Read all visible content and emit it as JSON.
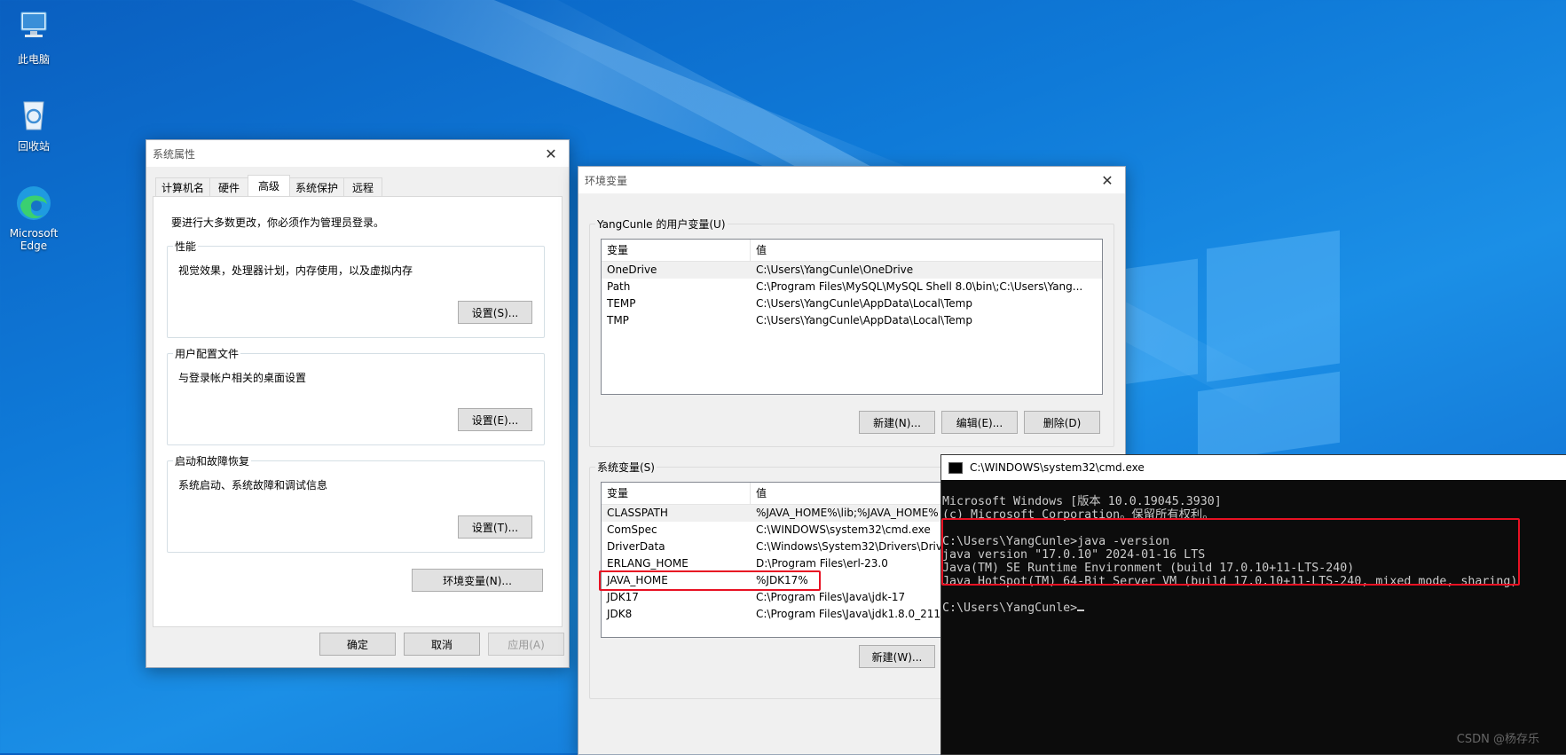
{
  "desktop": {
    "icons": [
      {
        "label": "此电脑",
        "icon": "this-pc-icon"
      },
      {
        "label": "回收站",
        "icon": "recycle-bin-icon"
      },
      {
        "label": "Microsoft Edge",
        "icon": "edge-icon"
      }
    ]
  },
  "sys_props": {
    "title": "系统属性",
    "tabs": [
      "计算机名",
      "硬件",
      "高级",
      "系统保护",
      "远程"
    ],
    "active_tab": "高级",
    "admin_note": "要进行大多数更改，你必须作为管理员登录。",
    "performance": {
      "legend": "性能",
      "desc": "视觉效果，处理器计划，内存使用，以及虚拟内存",
      "button": "设置(S)..."
    },
    "user_profile": {
      "legend": "用户配置文件",
      "desc": "与登录帐户相关的桌面设置",
      "button": "设置(E)..."
    },
    "startup": {
      "legend": "启动和故障恢复",
      "desc": "系统启动、系统故障和调试信息",
      "button": "设置(T)..."
    },
    "env_button": "环境变量(N)...",
    "ok": "确定",
    "cancel": "取消",
    "apply": "应用(A)"
  },
  "env_vars": {
    "title": "环境变量",
    "user_section": "YangCunle 的用户变量(U)",
    "col_var": "变量",
    "col_val": "值",
    "user_rows": [
      {
        "name": "OneDrive",
        "value": "C:\\Users\\YangCunle\\OneDrive"
      },
      {
        "name": "Path",
        "value": "C:\\Program Files\\MySQL\\MySQL Shell 8.0\\bin\\;C:\\Users\\Yang..."
      },
      {
        "name": "TEMP",
        "value": "C:\\Users\\YangCunle\\AppData\\Local\\Temp"
      },
      {
        "name": "TMP",
        "value": "C:\\Users\\YangCunle\\AppData\\Local\\Temp"
      }
    ],
    "user_buttons": {
      "new": "新建(N)...",
      "edit": "编辑(E)...",
      "delete": "删除(D)"
    },
    "sys_section": "系统变量(S)",
    "sys_rows": [
      {
        "name": "CLASSPATH",
        "value": "%JAVA_HOME%\\lib;%JAVA_HOME%"
      },
      {
        "name": "ComSpec",
        "value": "C:\\WINDOWS\\system32\\cmd.exe"
      },
      {
        "name": "DriverData",
        "value": "C:\\Windows\\System32\\Drivers\\Driv"
      },
      {
        "name": "ERLANG_HOME",
        "value": "D:\\Program Files\\erl-23.0"
      },
      {
        "name": "JAVA_HOME",
        "value": "%JDK17%"
      },
      {
        "name": "JDK17",
        "value": "C:\\Program Files\\Java\\jdk-17"
      },
      {
        "name": "JDK8",
        "value": "C:\\Program Files\\Java\\jdk1.8.0_211"
      }
    ],
    "sys_new": "新建(W)..."
  },
  "cmd": {
    "title": "C:\\WINDOWS\\system32\\cmd.exe",
    "lines": [
      "Microsoft Windows [版本 10.0.19045.3930]",
      "(c) Microsoft Corporation。保留所有权利。",
      "",
      "C:\\Users\\YangCunle>java -version",
      "java version \"17.0.10\" 2024-01-16 LTS",
      "Java(TM) SE Runtime Environment (build 17.0.10+11-LTS-240)",
      "Java HotSpot(TM) 64-Bit Server VM (build 17.0.10+11-LTS-240, mixed mode, sharing)",
      "",
      "C:\\Users\\YangCunle>"
    ]
  },
  "watermark": "CSDN @杨存乐",
  "colors": {
    "highlight": "#e81123",
    "desktop_blue": "#0f7ad8"
  }
}
